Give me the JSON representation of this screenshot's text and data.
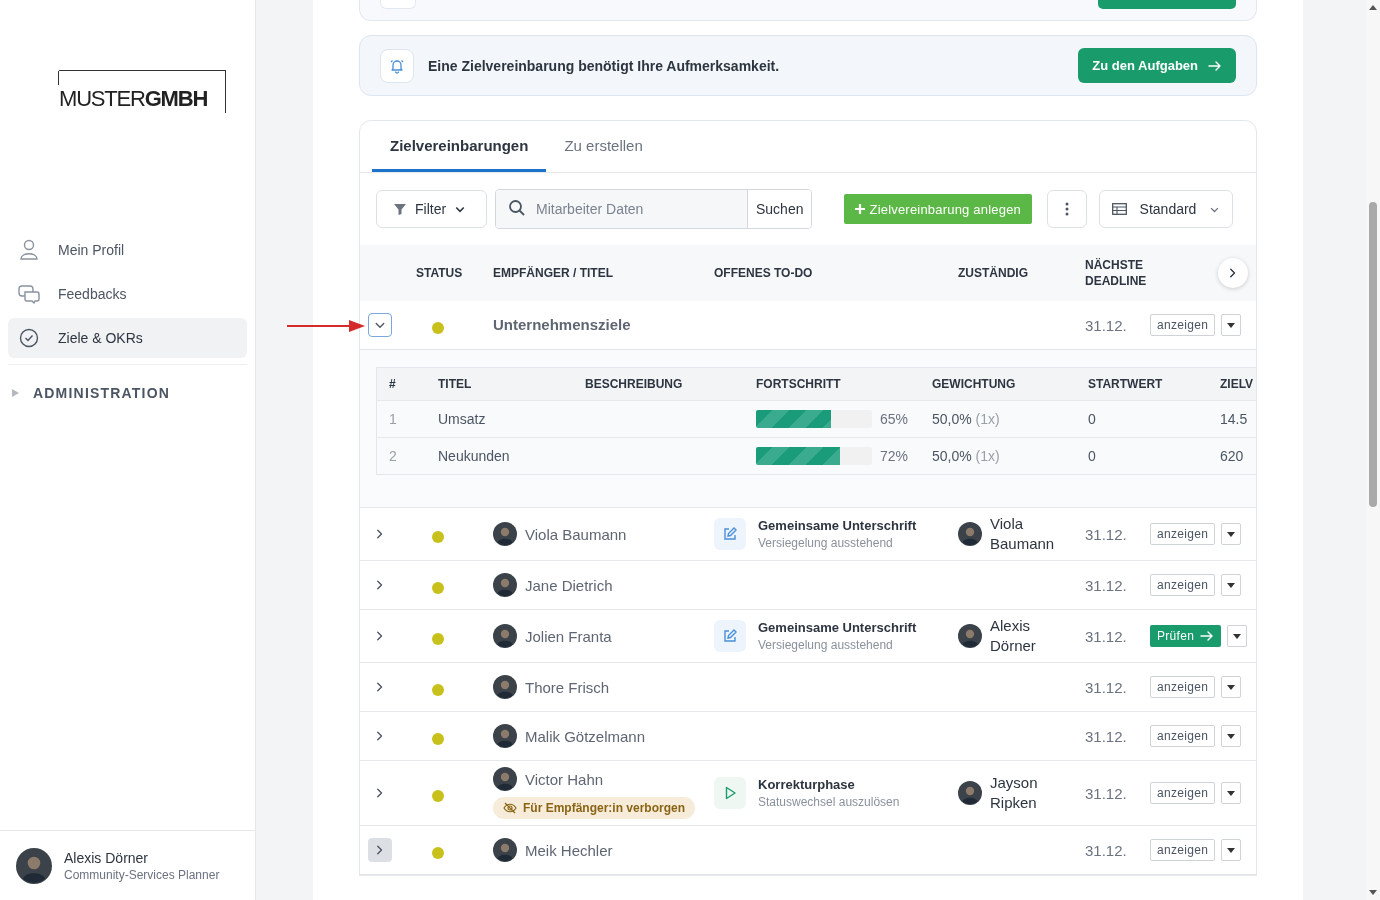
{
  "sidebar": {
    "logo": "MUSTER**GMBH**",
    "nav": [
      {
        "label": "Mein Profil",
        "selected": false
      },
      {
        "label": "Feedbacks",
        "selected": false
      },
      {
        "label": "Ziele & OKRs",
        "selected": true
      }
    ],
    "section": {
      "label": "ADMINISTRATION",
      "expanded": false
    },
    "user": {
      "name": "Alexis Dörner",
      "role": "Community-Services Planner"
    }
  },
  "notice": {
    "text": "Eine Zielvereinbarung benötigt Ihre Aufmerksamkeit.",
    "button": "Zu den Aufgaben"
  },
  "tabs": [
    {
      "label": "Zielvereinbarungen",
      "selected": true
    },
    {
      "label": "Zu erstellen",
      "selected": false
    }
  ],
  "toolbar": {
    "filter": "Filter",
    "search_placeholder": "Mitarbeiter Daten",
    "search_button": "Suchen",
    "create_button": "Zielvereinbarung anlegen",
    "view": "Standard"
  },
  "table": {
    "columns": [
      "STATUS",
      "EMPFÄNGER / TITEL",
      "OFFENES TO-DO",
      "ZUSTÄNDIG",
      "NÄCHSTE DEADLINE"
    ],
    "rows": [
      {
        "kind": "group",
        "title": "Unternehmensziele",
        "expanded": true,
        "highlighted": false,
        "color": "#c9c11b",
        "deadline": "31.12.",
        "action": {
          "kind": "view",
          "label": "anzeigen"
        },
        "goals": {
          "columns": [
            "#",
            "TITEL",
            "BESCHREIBUNG",
            "FORTSCHRITT",
            "GEWICHTUNG",
            "STARTWERT",
            "ZIELV"
          ],
          "rows": [
            {
              "index": "1",
              "title": "Umsatz",
              "level": 0.65,
              "progress": "65%",
              "weight": "50,0%",
              "factor": "(1x)",
              "start": "0",
              "target": "14.5"
            },
            {
              "index": "2",
              "title": "Neukunden",
              "level": 0.72,
              "progress": "72%",
              "weight": "50,0%",
              "factor": "(1x)",
              "start": "0",
              "target": "620"
            }
          ]
        }
      },
      {
        "kind": "person",
        "name": "Viola Baumann",
        "expanded": false,
        "highlighted": false,
        "color": "#c9c11b",
        "todo": {
          "kind": "sign",
          "title": "Gemeinsame Unterschrift",
          "subtitle": "Versiegelung ausstehend"
        },
        "assignee": "Viola Baumann",
        "deadline": "31.12.",
        "action": {
          "kind": "view",
          "label": "anzeigen"
        }
      },
      {
        "kind": "person",
        "name": "Jane Dietrich",
        "expanded": false,
        "highlighted": false,
        "color": "#c9c11b",
        "deadline": "31.12.",
        "action": {
          "kind": "view",
          "label": "anzeigen"
        }
      },
      {
        "kind": "person",
        "name": "Jolien Franta",
        "expanded": false,
        "highlighted": false,
        "color": "#c9c11b",
        "todo": {
          "kind": "sign",
          "title": "Gemeinsame Unterschrift",
          "subtitle": "Versiegelung ausstehend"
        },
        "assignee": "Alexis Dörner",
        "deadline": "31.12.",
        "action": {
          "kind": "review",
          "label": "Prüfen"
        }
      },
      {
        "kind": "person",
        "name": "Thore Frisch",
        "expanded": false,
        "highlighted": false,
        "color": "#c9c11b",
        "deadline": "31.12.",
        "action": {
          "kind": "view",
          "label": "anzeigen"
        }
      },
      {
        "kind": "person",
        "name": "Malik Götzelmann",
        "expanded": false,
        "highlighted": false,
        "color": "#c9c11b",
        "deadline": "31.12.",
        "action": {
          "kind": "view",
          "label": "anzeigen"
        }
      },
      {
        "kind": "person",
        "name": "Victor Hahn",
        "expanded": false,
        "highlighted": false,
        "color": "#c9c11b",
        "badge": "Für Empfänger:in verborgen",
        "todo": {
          "kind": "phase",
          "title": "Korrekturphase",
          "subtitle": "Statuswechsel auszulösen"
        },
        "assignee": "Jayson Ripken",
        "deadline": "31.12.",
        "action": {
          "kind": "view",
          "label": "anzeigen"
        }
      },
      {
        "kind": "person",
        "name": "Meik Hechler",
        "expanded": false,
        "highlighted": true,
        "color": "#c9c11b",
        "deadline": "31.12.",
        "action": {
          "kind": "view",
          "label": "anzeigen"
        }
      }
    ]
  }
}
